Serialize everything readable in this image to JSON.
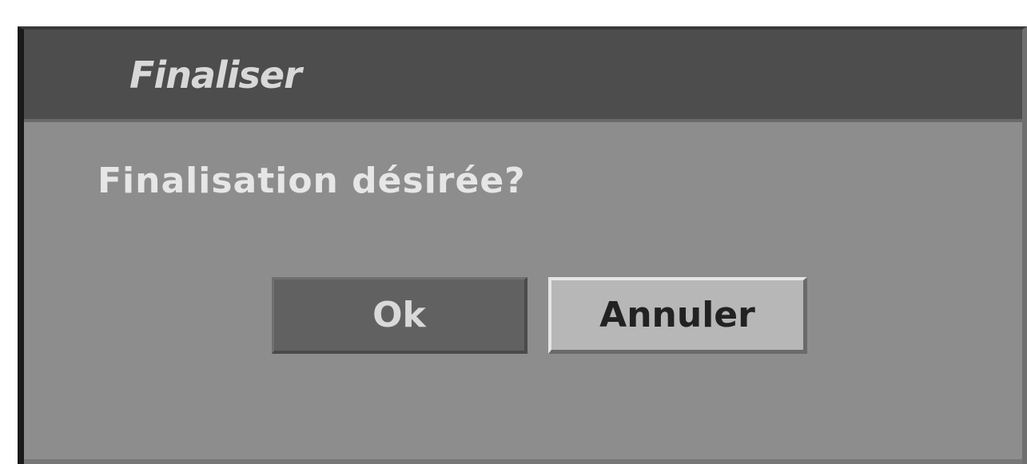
{
  "dialog": {
    "title": "Finaliser",
    "message": "Finalisation désirée?",
    "buttons": {
      "ok_label": "Ok",
      "cancel_label": "Annuler"
    },
    "selected_button": "cancel"
  },
  "colors": {
    "dialog_background": "#8d8d8d",
    "titlebar_background": "#4d4d4d",
    "ok_button_background": "#616161",
    "cancel_button_background": "#b7b7b7"
  }
}
